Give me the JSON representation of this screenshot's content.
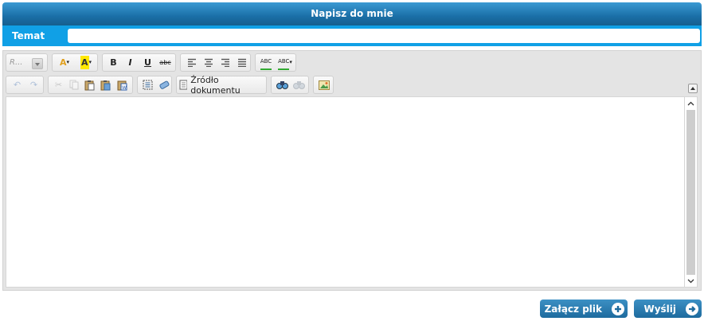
{
  "window": {
    "title": "Napisz do mnie"
  },
  "subject": {
    "label": "Temat",
    "value": "",
    "placeholder": ""
  },
  "toolbar": {
    "format_combo": "R...",
    "source_label": "Źródło dokumentu",
    "buttons": {
      "text_color": "A",
      "bg_color": "A",
      "bold": "B",
      "italic": "I",
      "underline": "U",
      "strike": "abc",
      "spell1": "ABC",
      "spell2": "ABC"
    }
  },
  "editor": {
    "content": ""
  },
  "actions": {
    "attach_label": "Załącz plik",
    "send_label": "Wyślij"
  },
  "colors": {
    "title_bar": "#1a6fa7",
    "subject_bar": "#10a0e6",
    "button": "#2a7db1"
  }
}
